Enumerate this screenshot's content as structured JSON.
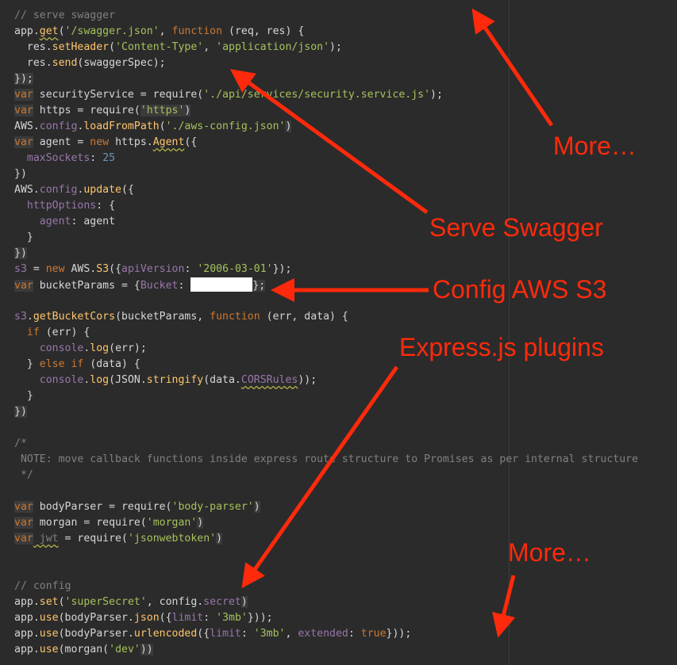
{
  "code": {
    "l1": "// serve swagger",
    "l2": {
      "a": "app.",
      "b": "get",
      "c": "(",
      "d": "'/swagger.json'",
      "e": ", ",
      "f": "function",
      "g": " (req, res) {"
    },
    "l3": {
      "a": "res.",
      "b": "setHeader",
      "c": "(",
      "d": "'Content-Type'",
      "e": ", ",
      "f": "'application/json'",
      "g": ");"
    },
    "l4": {
      "a": "res.",
      "b": "send",
      "c": "(swaggerSpec);"
    },
    "l5": "});",
    "l6": {
      "a": "var",
      "b": " securityService = require(",
      "c": "'./api/services/security.service.js'",
      "d": ");"
    },
    "l7": {
      "a": "var",
      "b": " https = require(",
      "c": "'https'",
      "d": ")"
    },
    "l8": {
      "a": "AWS.",
      "b": "config",
      "c": ".",
      "d": "loadFromPath",
      "e": "(",
      "f": "'./aws-config.json'",
      "g": ")"
    },
    "l9": {
      "a": "var",
      "b": " agent = ",
      "c": "new",
      "d": " https.",
      "e": "Agent",
      "f": "({"
    },
    "l10": {
      "a": "maxSockets",
      "b": ": ",
      "c": "25"
    },
    "l11": "})",
    "l12": {
      "a": "AWS.",
      "b": "config",
      "c": ".",
      "d": "update",
      "e": "({"
    },
    "l13": {
      "a": "httpOptions",
      "b": ": {"
    },
    "l14": {
      "a": "agent",
      "b": ": agent"
    },
    "l15": "}",
    "l16": "})",
    "l17": {
      "a": "s3",
      "b": " = ",
      "c": "new",
      "d": " AWS.",
      "e": "S3",
      "f": "({",
      "g": "apiVersion",
      "h": ": ",
      "i": "'2006-03-01'",
      "j": "});"
    },
    "l18": {
      "a": "var",
      "b": " bucketParams = {",
      "c": "Bucket",
      "d": ": ",
      "e": "};"
    },
    "l19": {
      "a": "s3",
      "b": ".",
      "c": "getBucketCors",
      "d": "(bucketParams, ",
      "e": "function",
      "f": " (err, data) {"
    },
    "l20": {
      "a": "if",
      "b": " (err) {"
    },
    "l21": {
      "a": "console",
      "b": ".",
      "c": "log",
      "d": "(err);"
    },
    "l22": {
      "a": "} ",
      "b": "else if",
      "c": " (data) {"
    },
    "l23": {
      "a": "console",
      "b": ".",
      "c": "log",
      "d": "(JSON.",
      "e": "stringify",
      "f": "(data.",
      "g": "CORSRules",
      "h": "));"
    },
    "l24": "}",
    "l25": "})",
    "l26": "/*",
    "l27": " NOTE: move callback functions inside express route structure to Promises as per internal structure",
    "l28": " */",
    "l29": {
      "a": "var",
      "b": " bodyParser = require(",
      "c": "'body-parser'",
      "d": ")"
    },
    "l30": {
      "a": "var",
      "b": " morgan = require(",
      "c": "'morgan'",
      "d": ")"
    },
    "l31": {
      "a": "var",
      "b": " jwt",
      "c": " = require(",
      "d": "'jsonwebtoken'",
      "e": ")"
    },
    "l32": "// config",
    "l33": {
      "a": "app.",
      "b": "set",
      "c": "(",
      "d": "'superSecret'",
      "e": ", config.",
      "f": "secret",
      "g": ")"
    },
    "l34": {
      "a": "app.",
      "b": "use",
      "c": "(bodyParser.",
      "d": "json",
      "e": "({",
      "f": "limit",
      "g": ": ",
      "h": "'3mb'",
      "i": "}));"
    },
    "l35": {
      "a": "app.",
      "b": "use",
      "c": "(bodyParser.",
      "d": "urlencoded",
      "e": "({",
      "f": "limit",
      "g": ": ",
      "h": "'3mb'",
      "i": ", ",
      "j": "extended",
      "k": ": ",
      "l": "true",
      "m": "}));"
    },
    "l36": {
      "a": "app.",
      "b": "use",
      "c": "(morgan(",
      "d": "'dev'",
      "e": "))"
    }
  },
  "annotations": {
    "more_top": "More…",
    "serve_swagger": "Serve Swagger",
    "config_aws_s3": "Config AWS S3",
    "express_plugins": "Express.js plugins",
    "more_bottom": "More…"
  },
  "colors": {
    "background": "#2b2b2b",
    "keyword": "#cc7832",
    "string": "#a5c25c",
    "function": "#ffc66d",
    "property": "#9876aa",
    "number": "#6897bb",
    "comment": "#808080",
    "annotation": "#ff2a0b"
  }
}
